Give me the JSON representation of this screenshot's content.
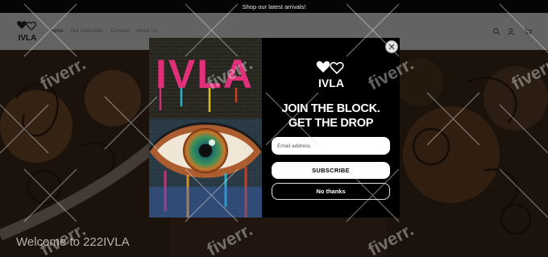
{
  "announcement": {
    "text": "Shop our latest arrivals!"
  },
  "header": {
    "logo_text": "IVLA",
    "nav": [
      {
        "label": "Home"
      },
      {
        "label": "Our Collection"
      },
      {
        "label": "Contact"
      },
      {
        "label": "About Us"
      }
    ],
    "icons": [
      "search-icon",
      "account-icon",
      "cart-icon"
    ]
  },
  "hero": {
    "welcome": "Welcome to 222IVLA"
  },
  "popup": {
    "image_text": "IVLA",
    "logo_text": "IVLA",
    "title_line1": "JOIN THE BLOCK.",
    "title_line2": "GET THE DROP",
    "email_placeholder": "Email address",
    "subscribe_label": "SUBSCRIBE",
    "no_thanks_label": "No thanks",
    "close_icon": "close-icon"
  },
  "watermark": {
    "text": "fiverr."
  },
  "colors": {
    "announcement_bg": "#050505",
    "header_bg": "#636363",
    "popup_bg": "#000000",
    "button_bg": "#ffffff"
  }
}
